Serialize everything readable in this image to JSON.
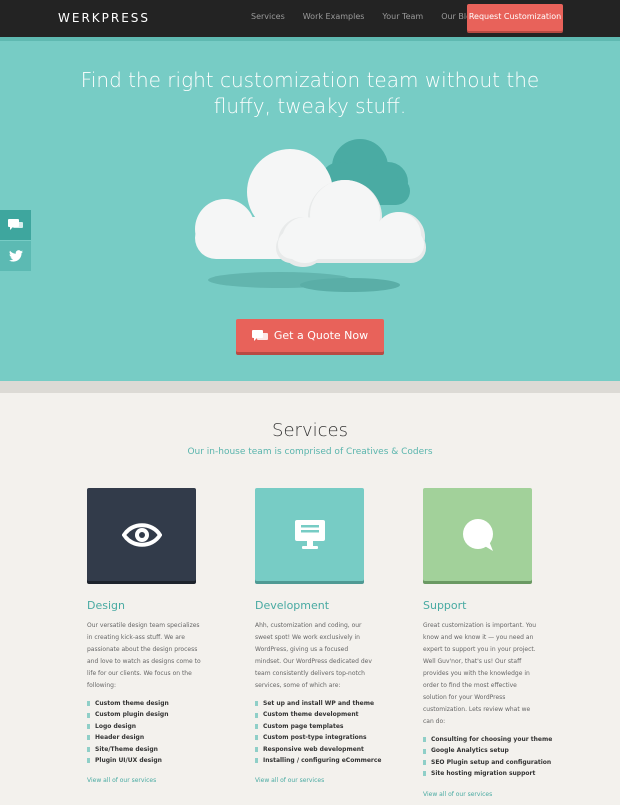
{
  "nav": {
    "logo": "WERKPRESS",
    "links": [
      "Services",
      "Work Examples",
      "Your Team",
      "Our Blog"
    ],
    "cta": "Request Customization"
  },
  "hero": {
    "title": "Find the right customization team without the fluffy, tweaky stuff.",
    "cta": "Get a Quote Now"
  },
  "services": {
    "title": "Services",
    "subtitle": "Our in-house team is comprised of Creatives & Coders",
    "columns": [
      {
        "icon": "eye-icon",
        "heading": "Design",
        "text": "Our versatile design team specializes in creating kick-ass stuff. We are passionate about the design process and love to watch as designs come to life for our clients. We focus on the following:",
        "items": [
          "Custom theme design",
          "Custom plugin design",
          "Logo design",
          "Header design",
          "Site/Theme design",
          "Plugin UI/UX design"
        ],
        "link": "View all of our services",
        "color": "#323b4a"
      },
      {
        "icon": "monitor-icon",
        "heading": "Development",
        "text": "Ahh, customization and coding, our sweet spot! We work exclusively in WordPress, giving us a focused mindset. Our WordPress dedicated dev team consistently delivers top-notch services, some of which are:",
        "items": [
          "Set up and install WP and theme",
          "Custom theme development",
          "Custom page templates",
          "Custom post-type integrations",
          "Responsive web development",
          "Installing / configuring eCommerce"
        ],
        "link": "View all of our services",
        "color": "#77ccc5"
      },
      {
        "icon": "speech-bubble-icon",
        "heading": "Support",
        "text": "Great customization is important. You know and we know it — you need an expert to support you in your project. Well Guv'nor, that's us! Our staff provides you with the knowledge in order to find the most effective solution for your WordPress customization. Lets review what we can do:",
        "items": [
          "Consulting for choosing your theme",
          "Google Analytics setup",
          "SEO Plugin setup and configuration",
          "Site hosting migration support"
        ],
        "link": "View all of our services",
        "color": "#a2d19a"
      }
    ]
  },
  "side": {
    "icons": [
      "chat-icon",
      "twitter-icon"
    ]
  },
  "colors": {
    "accent": "#e8625a",
    "teal": "#77ccc5",
    "dark": "#232323"
  }
}
